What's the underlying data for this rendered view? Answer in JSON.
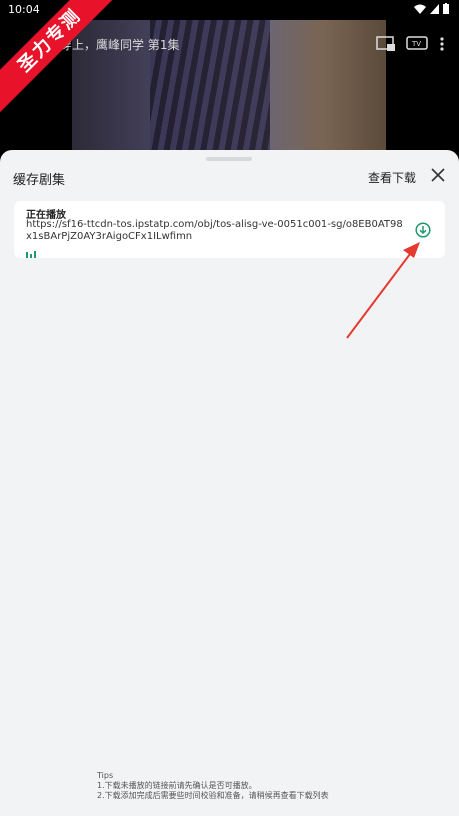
{
  "status_bar": {
    "time": "10:04"
  },
  "video": {
    "title": "穿上，鹰峰同学 第1集"
  },
  "watermark": {
    "text": "圣力专测"
  },
  "sheet": {
    "title": "缓存剧集",
    "view_downloads": "查看下载"
  },
  "item": {
    "playing_label": "正在播放",
    "url": "https://sf16-ttcdn-tos.ipstatp.com/obj/tos-alisg-ve-0051c001-sg/o8EB0AT98x1sBArPjZ0AY3rAigoCFx1ILwfimn"
  },
  "tips": {
    "heading": "Tips",
    "line1": "1.下载未播放的链接前请先确认是否可播放。",
    "line2": "2.下载添加完成后需要些时间校验和准备，请稍候再查看下载列表"
  },
  "colors": {
    "accent": "#1f9a6c",
    "annotation_arrow": "#e53a2f"
  }
}
